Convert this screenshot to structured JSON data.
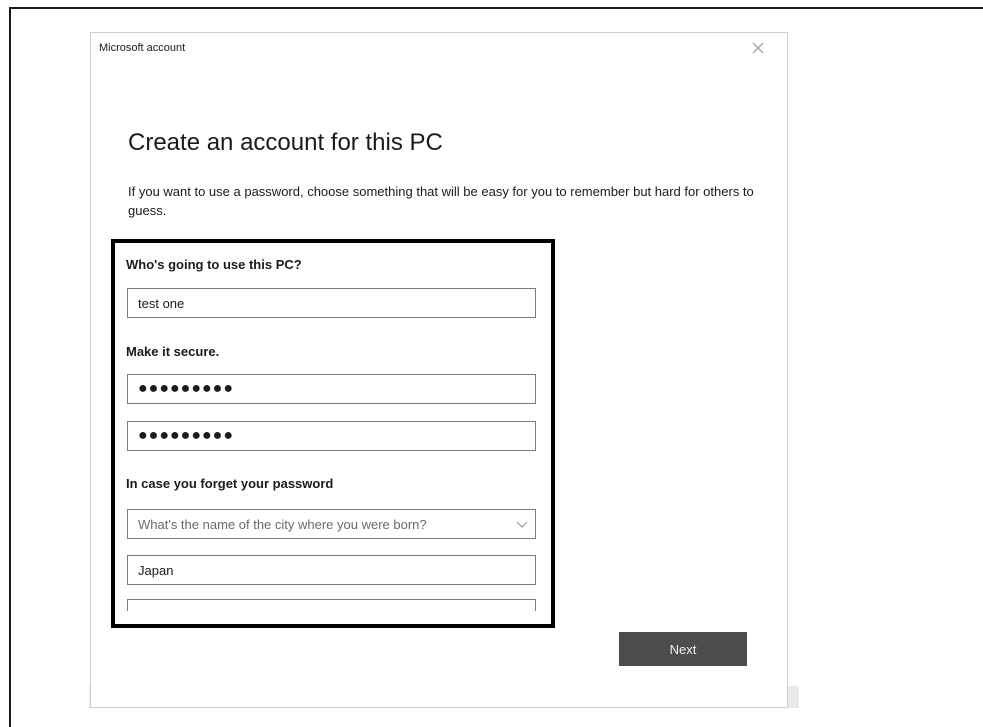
{
  "window": {
    "title": "Microsoft account",
    "close_icon": "close-icon"
  },
  "heading": "Create an account for this PC",
  "description": "If you want to use a password, choose something that will be easy for you to remember but hard for others to guess.",
  "user_section": {
    "label": "Who's going to use this PC?",
    "username_value": "test one"
  },
  "secure_section": {
    "label": "Make it secure.",
    "password_value": "●●●●●●●●●",
    "confirm_password_value": "●●●●●●●●●"
  },
  "recovery_section": {
    "label": "In case you forget your password",
    "question_selected": "What's the name of the city where you were born?",
    "answer_value": "Japan"
  },
  "next_button_label": "Next",
  "colors": {
    "button_bg": "#4d4d4d",
    "highlight_border": "#000000"
  }
}
